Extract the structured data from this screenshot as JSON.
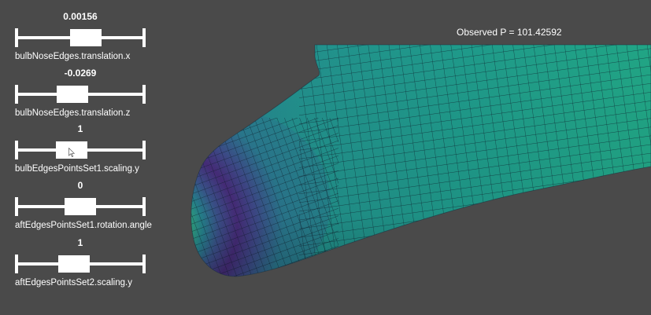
{
  "observed": {
    "text": "Observed P = 101.42592"
  },
  "sliders": [
    {
      "value": "0.00156",
      "label": "bulbNoseEdges.translation.x",
      "level": 0.56
    },
    {
      "value": "-0.0269",
      "label": "bulbNoseEdges.translation.z",
      "level": 0.41
    },
    {
      "value": "1",
      "label": "bulbEdgesPointsSet1.scaling.y",
      "level": 0.4
    },
    {
      "value": "0",
      "label": "aftEdgesPointsSet1.rotation.angle",
      "level": 0.5
    },
    {
      "value": "1",
      "label": "aftEdgesPointsSet2.scaling.y",
      "level": 0.43
    }
  ],
  "colors": {
    "background": "#4a4a4a",
    "widget": "#ffffff",
    "colormap": [
      "#440154",
      "#3b528b",
      "#21918c",
      "#5ec962",
      "#fde725"
    ]
  },
  "icons": {
    "cursor": "mouse-pointer-icon"
  }
}
